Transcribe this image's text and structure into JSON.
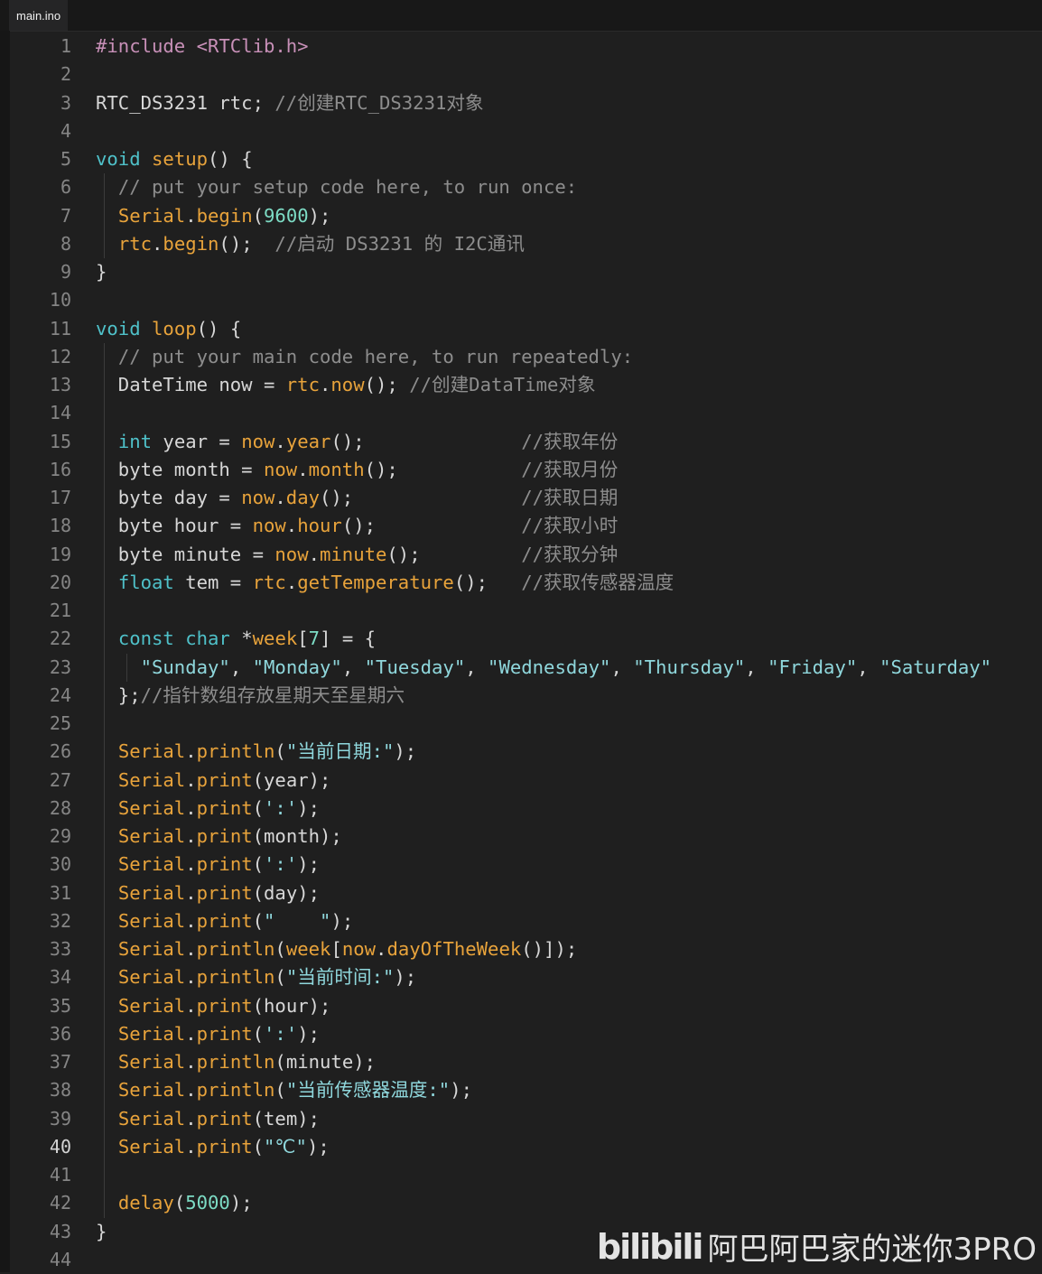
{
  "tab": {
    "title": "main.ino"
  },
  "editor": {
    "active_line": 40,
    "line_numbers": [
      "1",
      "2",
      "3",
      "4",
      "5",
      "6",
      "7",
      "8",
      "9",
      "10",
      "11",
      "12",
      "13",
      "14",
      "15",
      "16",
      "17",
      "18",
      "19",
      "20",
      "21",
      "22",
      "23",
      "24",
      "25",
      "26",
      "27",
      "28",
      "29",
      "30",
      "31",
      "32",
      "33",
      "34",
      "35",
      "36",
      "37",
      "38",
      "39",
      "40",
      "41",
      "42",
      "43",
      "44"
    ],
    "lines": [
      "#include <RTClib.h>",
      "",
      "RTC_DS3231 rtc; //创建RTC_DS3231对象",
      "",
      "void setup() {",
      "  // put your setup code here, to run once:",
      "  Serial.begin(9600);",
      "  rtc.begin();  //启动 DS3231 的 I2C通讯",
      "}",
      "",
      "void loop() {",
      "  // put your main code here, to run repeatedly:",
      "  DateTime now = rtc.now(); //创建DataTime对象",
      "",
      "  int year = now.year();              //获取年份",
      "  byte month = now.month();           //获取月份",
      "  byte day = now.day();               //获取日期",
      "  byte hour = now.hour();             //获取小时",
      "  byte minute = now.minute();         //获取分钟",
      "  float tem = rtc.getTemperature();   //获取传感器温度",
      "",
      "  const char *week[7] = {",
      "    \"Sunday\", \"Monday\", \"Tuesday\", \"Wednesday\", \"Thursday\", \"Friday\", \"Saturday\"",
      "  };//指针数组存放星期天至星期六",
      "",
      "  Serial.println(\"当前日期:\");",
      "  Serial.print(year);",
      "  Serial.print(':');",
      "  Serial.print(month);",
      "  Serial.print(':');",
      "  Serial.print(day);",
      "  Serial.print(\"    \");",
      "  Serial.println(week[now.dayOfTheWeek()]);",
      "  Serial.println(\"当前时间:\");",
      "  Serial.print(hour);",
      "  Serial.print(':');",
      "  Serial.println(minute);",
      "  Serial.println(\"当前传感器温度:\");",
      "  Serial.print(tem);",
      "  Serial.print(\"℃\");",
      "",
      "  delay(5000);",
      "}",
      ""
    ]
  },
  "watermark": {
    "logo": "bilibili",
    "text": "阿巴阿巴家的迷你3PRO"
  },
  "colors": {
    "background": "#1f1f1f",
    "keyword": "#4fc1c9",
    "function": "#e8a33b",
    "string": "#8fd7dc",
    "comment": "#8d8d8d",
    "preprocessor": "#c890b8"
  }
}
